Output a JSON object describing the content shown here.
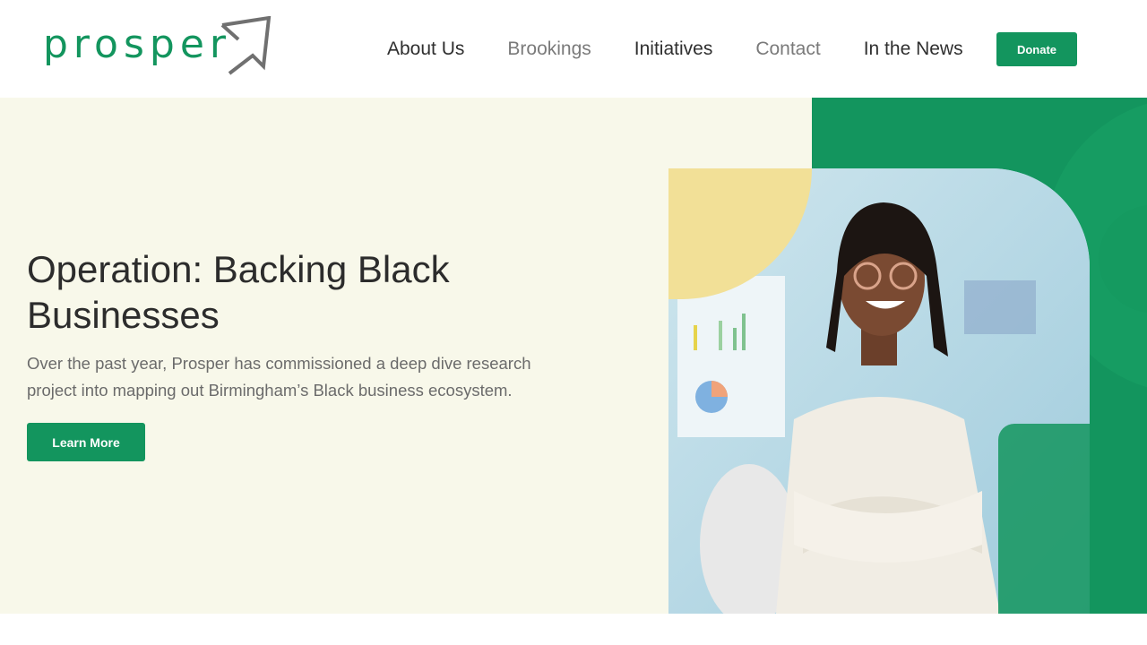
{
  "brand": {
    "name": "prosper",
    "accent_color": "#13955e",
    "logo_icon": "arrow-up-right-icon"
  },
  "nav": {
    "items": [
      {
        "label": "About Us"
      },
      {
        "label": "Brookings"
      },
      {
        "label": "Initiatives"
      },
      {
        "label": "Contact"
      },
      {
        "label": "In the News"
      }
    ],
    "donate_label": "Donate"
  },
  "hero": {
    "title": "Operation: Backing Black Businesses",
    "description": "Over the past year, Prosper has commissioned a deep dive research project into mapping out Birmingham’s Black business ecosystem.",
    "cta_label": "Learn More",
    "background_color": "#f8f8ea",
    "image_subject": "person"
  }
}
